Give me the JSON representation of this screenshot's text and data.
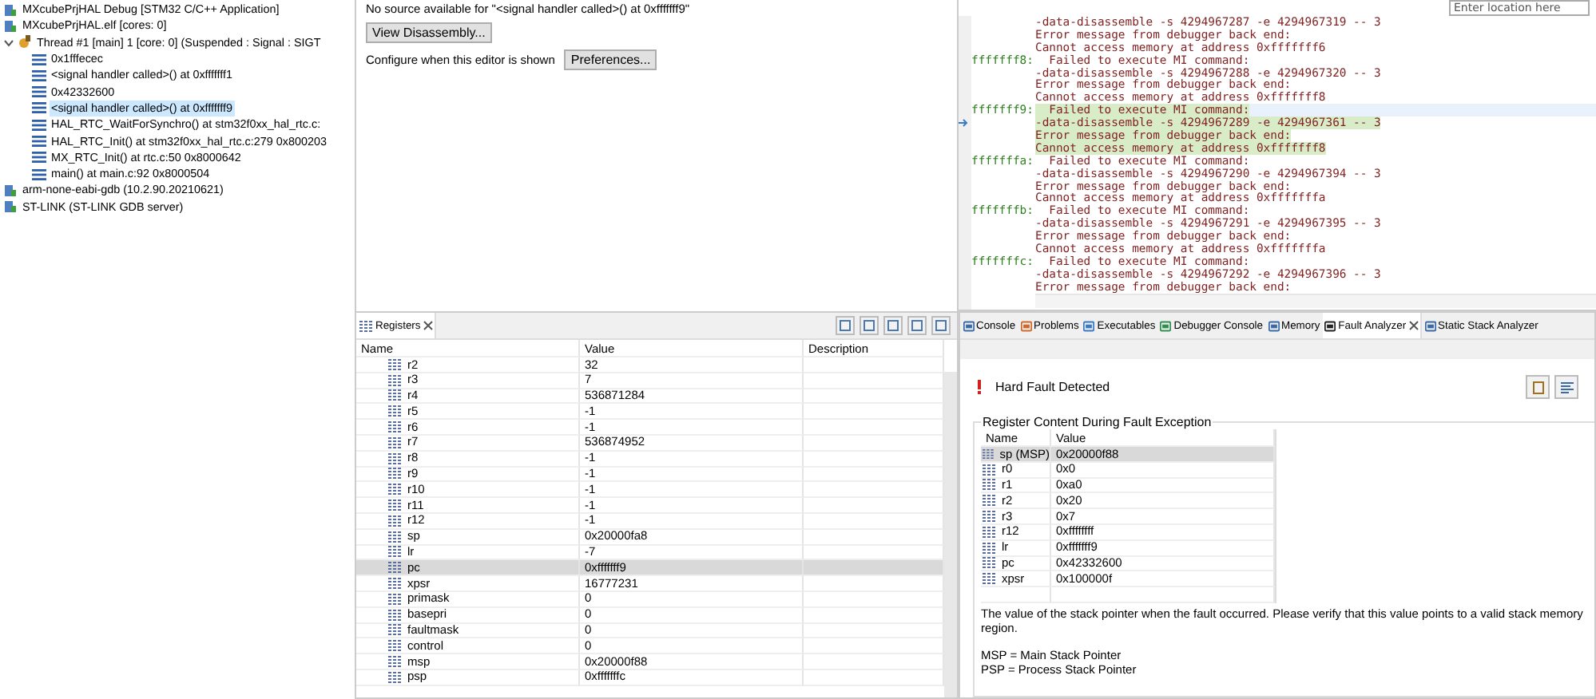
{
  "debug_tree": {
    "launch": "MXcubePrjHAL Debug [STM32 C/C++ Application]",
    "target": "MXcubePrjHAL.elf [cores: 0]",
    "thread": {
      "label": "Thread #1 [main] 1 [core: 0] (Suspended : Signal : SIGT",
      "expanded": true,
      "frames": [
        {
          "label": "0x1fffecec",
          "selected": false
        },
        {
          "label": "<signal handler called>() at 0xfffffff1",
          "selected": false
        },
        {
          "label": "0x42332600",
          "selected": false
        },
        {
          "label": "<signal handler called>() at 0xfffffff9",
          "selected": true
        },
        {
          "label": "HAL_RTC_WaitForSynchro() at stm32f0xx_hal_rtc.c:",
          "selected": false
        },
        {
          "label": "HAL_RTC_Init() at stm32f0xx_hal_rtc.c:279 0x800203",
          "selected": false
        },
        {
          "label": "MX_RTC_Init() at rtc.c:50 0x8000642",
          "selected": false
        },
        {
          "label": "main() at main.c:92 0x8000504",
          "selected": false
        }
      ]
    },
    "processes": [
      "arm-none-eabi-gdb (10.2.90.20210621)",
      "ST-LINK (ST-LINK GDB server)"
    ]
  },
  "editor": {
    "message": "No source available for \"<signal handler called>() at 0xfffffff9\"",
    "view_button": "View Disassembly...",
    "configure_label": "Configure when this editor is shown",
    "preferences_button": "Preferences..."
  },
  "disassembly": {
    "location_placeholder": "Enter location here",
    "lines": [
      {
        "text": "-data-disassemble -s 4294967287 -e 4294967319 -- 3",
        "current": false
      },
      {
        "text": "Error message from debugger back end:",
        "current": false
      },
      {
        "text": "Cannot access memory at address 0xfffffff6",
        "current": false
      },
      {
        "address": "fffffff8:",
        "text": "  Failed to execute MI command:",
        "current": false
      },
      {
        "text": "-data-disassemble -s 4294967288 -e 4294967320 -- 3",
        "current": false
      },
      {
        "text": "Error message from debugger back end:",
        "current": false
      },
      {
        "text": "Cannot access memory at address 0xfffffff8",
        "current": false
      },
      {
        "address": "fffffff9:",
        "text": "  Failed to execute MI command:",
        "current": true
      },
      {
        "text": "-data-disassemble -s 4294967289 -e 4294967361 -- 3",
        "current": true
      },
      {
        "text": "Error message from debugger back end:",
        "current": true
      },
      {
        "text": "Cannot access memory at address 0xfffffff8",
        "current": true
      },
      {
        "address": "fffffffa:",
        "text": "  Failed to execute MI command:",
        "current": false
      },
      {
        "text": "-data-disassemble -s 4294967290 -e 4294967394 -- 3",
        "current": false
      },
      {
        "text": "Error message from debugger back end:",
        "current": false
      },
      {
        "text": "Cannot access memory at address 0xfffffffa",
        "current": false
      },
      {
        "address": "fffffffb:",
        "text": "  Failed to execute MI command:",
        "current": false
      },
      {
        "text": "-data-disassemble -s 4294967291 -e 4294967395 -- 3",
        "current": false
      },
      {
        "text": "Error message from debugger back end:",
        "current": false
      },
      {
        "text": "Cannot access memory at address 0xfffffffa",
        "current": false
      },
      {
        "address": "fffffffc:",
        "text": "  Failed to execute MI command:",
        "current": false
      },
      {
        "text": "-data-disassemble -s 4294967292 -e 4294967396 -- 3",
        "current": false
      },
      {
        "text": "Error message from debugger back end:",
        "current": false
      }
    ]
  },
  "registers": {
    "tab": "Registers",
    "columns": [
      "Name",
      "Value",
      "Description"
    ],
    "rows": [
      {
        "name": "r2",
        "value": "32",
        "selected": false
      },
      {
        "name": "r3",
        "value": "7",
        "selected": false
      },
      {
        "name": "r4",
        "value": "536871284",
        "selected": false
      },
      {
        "name": "r5",
        "value": "-1",
        "selected": false
      },
      {
        "name": "r6",
        "value": "-1",
        "selected": false
      },
      {
        "name": "r7",
        "value": "536874952",
        "selected": false
      },
      {
        "name": "r8",
        "value": "-1",
        "selected": false
      },
      {
        "name": "r9",
        "value": "-1",
        "selected": false
      },
      {
        "name": "r10",
        "value": "-1",
        "selected": false
      },
      {
        "name": "r11",
        "value": "-1",
        "selected": false
      },
      {
        "name": "r12",
        "value": "-1",
        "selected": false
      },
      {
        "name": "sp",
        "value": "0x20000fa8",
        "selected": false
      },
      {
        "name": "lr",
        "value": "-7",
        "selected": false
      },
      {
        "name": "pc",
        "value": "0xfffffff9",
        "selected": true
      },
      {
        "name": "xpsr",
        "value": "16777231",
        "selected": false
      },
      {
        "name": "primask",
        "value": "0",
        "selected": false
      },
      {
        "name": "basepri",
        "value": "0",
        "selected": false
      },
      {
        "name": "faultmask",
        "value": "0",
        "selected": false
      },
      {
        "name": "control",
        "value": "0",
        "selected": false
      },
      {
        "name": "msp",
        "value": "0x20000f88",
        "selected": false
      },
      {
        "name": "psp",
        "value": "0xfffffffc",
        "selected": false
      }
    ]
  },
  "bottom_tabs": [
    {
      "label": "Console",
      "selected": false
    },
    {
      "label": "Problems",
      "selected": false
    },
    {
      "label": "Executables",
      "selected": false
    },
    {
      "label": "Debugger Console",
      "selected": false
    },
    {
      "label": "Memory",
      "selected": false
    },
    {
      "label": "Fault Analyzer",
      "selected": true
    },
    {
      "label": "Static Stack Analyzer",
      "selected": false
    }
  ],
  "fault_analyzer": {
    "status": "Hard Fault Detected",
    "group_title": "Register Content During Fault Exception",
    "columns": [
      "Name",
      "Value"
    ],
    "rows": [
      {
        "name": "sp (MSP)",
        "value": "0x20000f88",
        "selected": true
      },
      {
        "name": "r0",
        "value": "0x0",
        "selected": false
      },
      {
        "name": "r1",
        "value": "0xa0",
        "selected": false
      },
      {
        "name": "r2",
        "value": "0x20",
        "selected": false
      },
      {
        "name": "r3",
        "value": "0x7",
        "selected": false
      },
      {
        "name": "r12",
        "value": "0xffffffff",
        "selected": false
      },
      {
        "name": "lr",
        "value": "0xfffffff9",
        "selected": false
      },
      {
        "name": "pc",
        "value": "0x42332600",
        "selected": false
      },
      {
        "name": "xpsr",
        "value": "0x100000f",
        "selected": false
      }
    ],
    "description": "The value of the stack pointer when the fault occurred. Please verify that this value points to a valid stack memory region.",
    "legend": [
      "MSP = Main Stack Pointer",
      "PSP = Process Stack Pointer"
    ]
  }
}
